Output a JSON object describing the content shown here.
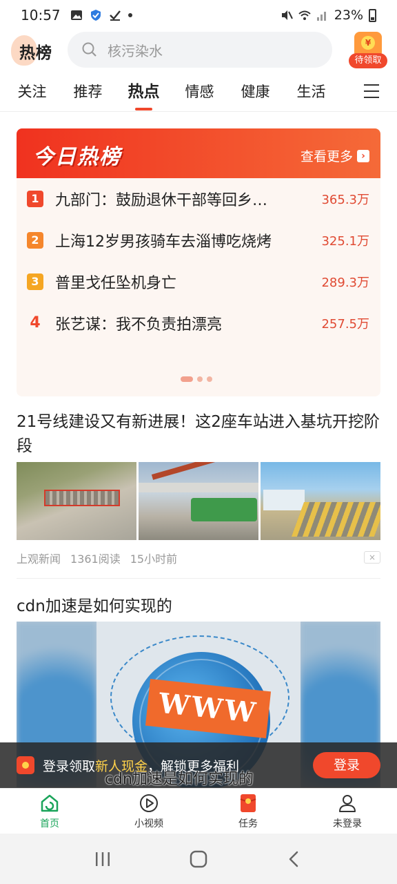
{
  "status_bar": {
    "time": "10:57",
    "battery": "23%"
  },
  "header": {
    "logo_text": "热榜",
    "search_placeholder": "核污染水",
    "redpack_label": "待领取",
    "redpack_coin": "¥"
  },
  "tabs": [
    {
      "label": "关注"
    },
    {
      "label": "推荐"
    },
    {
      "label": "热点",
      "active": true
    },
    {
      "label": "情感"
    },
    {
      "label": "健康"
    },
    {
      "label": "生活"
    }
  ],
  "hot_list": {
    "title": "今日热榜",
    "more": "查看更多",
    "items": [
      {
        "rank": "1",
        "title": "九部门：鼓励退休干部等回乡…",
        "heat": "365.3万"
      },
      {
        "rank": "2",
        "title": "上海12岁男孩骑车去淄博吃烧烤",
        "heat": "325.1万"
      },
      {
        "rank": "3",
        "title": "普里戈任坠机身亡",
        "heat": "289.3万"
      },
      {
        "rank": "4",
        "title": "张艺谋：我不负责拍漂亮",
        "heat": "257.5万"
      }
    ]
  },
  "feed": [
    {
      "title": "21号线建设又有新进展！这2座车站进入基坑开挖阶段",
      "source": "上观新闻",
      "reads": "1361阅读",
      "time": "15小时前",
      "close": "×"
    },
    {
      "title": "cdn加速是如何实现的",
      "image_text": "WWW",
      "subtitle": "cdn加速是如何实现的"
    }
  ],
  "login_banner": {
    "text_before": "登录领取",
    "highlight": "新人现金",
    "text_after": "，解锁更多福利",
    "button": "登录"
  },
  "bottom_nav": [
    {
      "label": "首页",
      "icon": "home-icon",
      "active": true
    },
    {
      "label": "小视频",
      "icon": "play-icon"
    },
    {
      "label": "任务",
      "icon": "task-redpack-icon"
    },
    {
      "label": "未登录",
      "icon": "user-icon"
    }
  ],
  "colors": {
    "accent": "#f0482c",
    "active_green": "#1aa45a",
    "rank1": "#f0482c",
    "rank2": "#f5862c",
    "rank3": "#f5a623"
  }
}
